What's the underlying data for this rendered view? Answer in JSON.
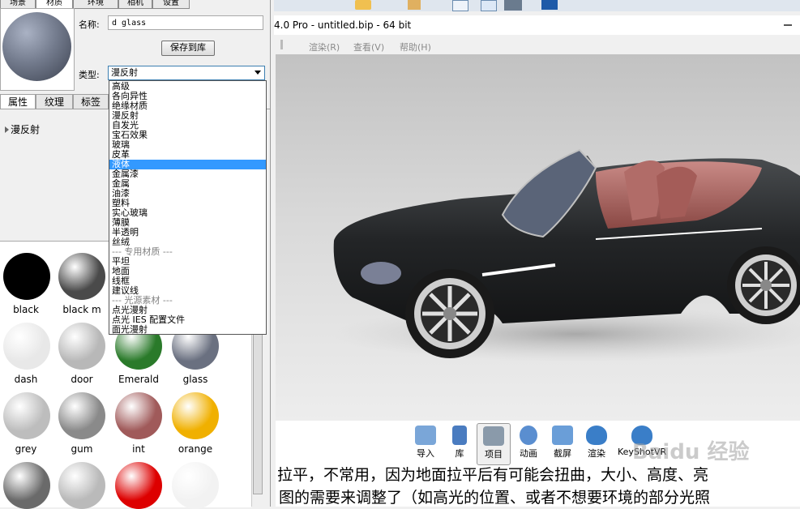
{
  "top_tabs": [
    "场景",
    "材质",
    "环境",
    "相机",
    "设置"
  ],
  "material": {
    "name_label": "名称:",
    "name_value": "d glass",
    "save_button": "保存到库",
    "type_label": "类型:",
    "type_value": "漫反射"
  },
  "props_tabs": [
    "属性",
    "纹理",
    "标签"
  ],
  "props_tree_item": "漫反射",
  "type_dropdown": {
    "items": [
      "高级",
      "各向异性",
      "绝缘材质",
      "漫反射",
      "自发光",
      "宝石效果",
      "玻璃",
      "皮革",
      "液体",
      "金属漆",
      "金属",
      "油漆",
      "塑料",
      "实心玻璃",
      "薄膜",
      "半透明",
      "丝绒",
      "---  专用材质  ---",
      "平坦",
      "地面",
      "线框",
      "建议线",
      "---  光源素材  ---",
      "点光漫射",
      "点光 IES 配置文件",
      "面光漫射"
    ],
    "selected": "液体"
  },
  "library": [
    {
      "name": "black",
      "color": "#000000"
    },
    {
      "name": "black m",
      "color": "#4a4a4a"
    },
    {
      "name": "",
      "color": "#555555"
    },
    {
      "name": "",
      "color": "#333333"
    },
    {
      "name": "dash",
      "color": "#e8e8e8"
    },
    {
      "name": "door",
      "color": "#b8b8b8"
    },
    {
      "name": "Emerald",
      "color": "#2a7a2a"
    },
    {
      "name": "glass",
      "color": "#6a7080"
    },
    {
      "name": "grey",
      "color": "#bdbdbd"
    },
    {
      "name": "gum",
      "color": "#8a8a8a"
    },
    {
      "name": "int",
      "color": "#a05a5a"
    },
    {
      "name": "orange",
      "color": "#f0b000"
    },
    {
      "name": "",
      "color": "#6a6a6a"
    },
    {
      "name": "",
      "color": "#bababa"
    },
    {
      "name": "",
      "color": "#dd0000"
    },
    {
      "name": "",
      "color": "#f2f2f2"
    }
  ],
  "app": {
    "title": "4.0 Pro  -  untitled.bip  -  64 bit",
    "menus": [
      "渲染(R)",
      "查看(V)",
      "帮助(H)"
    ]
  },
  "bottom_buttons": [
    "导入",
    "库",
    "项目",
    "动画",
    "截屏",
    "渲染",
    "KeyShotVR"
  ],
  "watermark": "Baidu 经验",
  "doc_lines": [
    "拉平，不常用，因为地面拉平后有可能会扭曲，大小、高度、亮",
    "图的需要来调整了（如高光的位置、或者不想要环境的部分光照"
  ]
}
